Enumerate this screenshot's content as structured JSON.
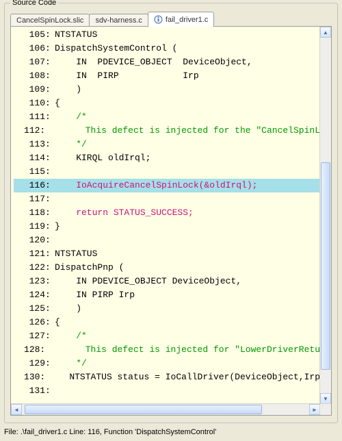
{
  "group_title": "Source Code",
  "tabs": [
    {
      "label": "CancelSpinLock.slic",
      "active": false,
      "icon": null
    },
    {
      "label": "sdv-harness.c",
      "active": false,
      "icon": null
    },
    {
      "label": "fail_driver1.c",
      "active": true,
      "icon": "info-icon"
    }
  ],
  "code": {
    "highlight_line": 116,
    "lines": [
      {
        "n": 105,
        "cls": "c-key",
        "text": "NTSTATUS"
      },
      {
        "n": 106,
        "cls": "c-key",
        "text": "DispatchSystemControl ("
      },
      {
        "n": 107,
        "cls": "c-key",
        "text": "    IN  PDEVICE_OBJECT  DeviceObject,"
      },
      {
        "n": 108,
        "cls": "c-key",
        "text": "    IN  PIRP            Irp"
      },
      {
        "n": 109,
        "cls": "c-key",
        "text": "    )"
      },
      {
        "n": 110,
        "cls": "c-key",
        "text": "{"
      },
      {
        "n": 111,
        "cls": "c-com",
        "text": "    /*"
      },
      {
        "n": 112,
        "cls": "c-com",
        "text": "       This defect is injected for the \"CancelSpinL"
      },
      {
        "n": 113,
        "cls": "c-com",
        "text": "    */"
      },
      {
        "n": 114,
        "cls": "c-key",
        "text": "    KIRQL oldIrql;"
      },
      {
        "n": 115,
        "cls": "c-key",
        "text": ""
      },
      {
        "n": 116,
        "cls": "c-err",
        "text": "    IoAcquireCancelSpinLock(&oldIrql);"
      },
      {
        "n": 117,
        "cls": "c-key",
        "text": ""
      },
      {
        "n": 118,
        "cls": "c-err",
        "text": "    return STATUS_SUCCESS;"
      },
      {
        "n": 119,
        "cls": "c-key",
        "text": "}"
      },
      {
        "n": 120,
        "cls": "c-key",
        "text": ""
      },
      {
        "n": 121,
        "cls": "c-key",
        "text": "NTSTATUS"
      },
      {
        "n": 122,
        "cls": "c-key",
        "text": "DispatchPnp ("
      },
      {
        "n": 123,
        "cls": "c-key",
        "text": "    IN PDEVICE_OBJECT DeviceObject,"
      },
      {
        "n": 124,
        "cls": "c-key",
        "text": "    IN PIRP Irp"
      },
      {
        "n": 125,
        "cls": "c-key",
        "text": "    )"
      },
      {
        "n": 126,
        "cls": "c-key",
        "text": "{"
      },
      {
        "n": 127,
        "cls": "c-com",
        "text": "    /*"
      },
      {
        "n": 128,
        "cls": "c-com",
        "text": "       This defect is injected for \"LowerDriverRetu"
      },
      {
        "n": 129,
        "cls": "c-com",
        "text": "    */"
      },
      {
        "n": 130,
        "cls": "c-key",
        "text": "    NTSTATUS status = IoCallDriver(DeviceObject,Irp"
      },
      {
        "n": 131,
        "cls": "c-key",
        "text": ""
      }
    ]
  },
  "vscroll": {
    "thumb_top_pct": 35,
    "thumb_height_pct": 58
  },
  "hscroll": {
    "thumb_left_pct": 1,
    "thumb_width_pct": 82
  },
  "status": "File: .\\fail_driver1.c   Line: 116,   Function 'DispatchSystemControl'"
}
